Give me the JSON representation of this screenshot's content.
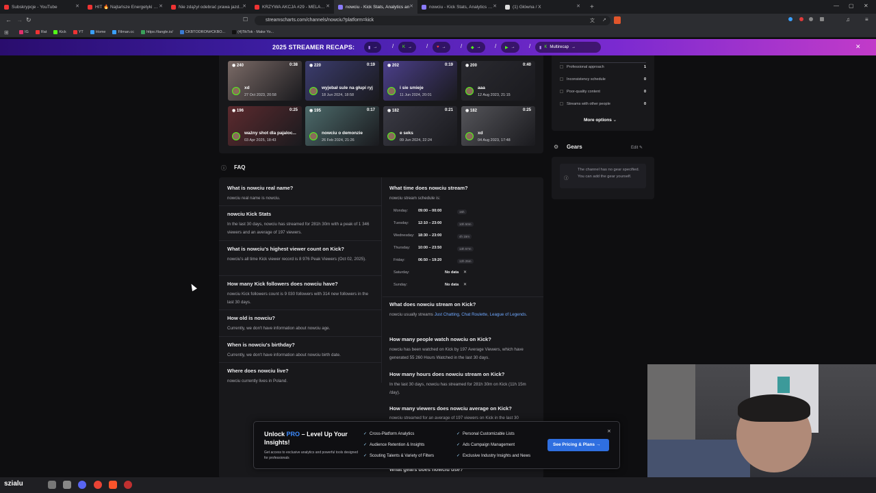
{
  "browser": {
    "tabs": [
      {
        "title": "Subskrypcje - YouTube",
        "color": "#e33"
      },
      {
        "title": "HIT 🔥 Najtańsze Energetyki W HIST",
        "color": "#e33"
      },
      {
        "title": "Nie zdążył odebrać prawa jazdy a już",
        "color": "#e33"
      },
      {
        "title": "KRZYWA AKCJA #29 - MELANŻOWA",
        "color": "#e33"
      },
      {
        "title": "nowciu - Kick Stats, Analytics an",
        "color": "#8a7bff"
      },
      {
        "title": "nowciu - Kick Stats, Analytics and Ch",
        "color": "#8a7bff"
      },
      {
        "title": "(1) Główna / X",
        "color": "#ddd"
      }
    ],
    "url": "streamscharts.com/channels/nowciu?platform=kick",
    "bookmarks": [
      "IG",
      "Rat",
      "Kick",
      "YT",
      "Home",
      "Filman.cc",
      "https://tangle.io/",
      "CKBTODRON#CKBO...",
      "(4)TikTok - Make Yo..."
    ]
  },
  "banner": {
    "title": "2025 STREAMER RECAPS:",
    "multirecap": "Multirecap"
  },
  "clips": [
    {
      "views": "240",
      "dur": "0:38",
      "title": "xd",
      "date": "27 Oct 2023, 20:58",
      "bg": "#7a6a66"
    },
    {
      "views": "220",
      "dur": "0:19",
      "title": "wyjebał sule na głupi ryj",
      "date": "18 Jun 2024, 18:58",
      "bg": "#3b3c6e"
    },
    {
      "views": "202",
      "dur": "0:19",
      "title": "i sie smieje",
      "date": "11 Jun 2024, 20:01",
      "bg": "#4b3f8a"
    },
    {
      "views": "200",
      "dur": "0:40",
      "title": "aaa",
      "date": "12 Aug 2023, 21:15",
      "bg": "#2a2a30"
    },
    {
      "views": "196",
      "dur": "0:25",
      "title": "ważny shot dla pajaloc...",
      "date": "03 Apr 2025, 18:43",
      "bg": "#5c2a2e"
    },
    {
      "views": "195",
      "dur": "0:17",
      "title": "nowciu o demonzie",
      "date": "26 Feb 2024, 21:26",
      "bg": "#4c6a6a"
    },
    {
      "views": "182",
      "dur": "0:21",
      "title": "e seks",
      "date": "09 Jun 2024, 22:24",
      "bg": "#3a3a44"
    },
    {
      "views": "182",
      "dur": "0:25",
      "title": "xd",
      "date": "04 Aug 2023, 17:48",
      "bg": "#55555a"
    }
  ],
  "right_panel": {
    "reasons": [
      {
        "label": "Professional approach",
        "count": "1"
      },
      {
        "label": "Inconsistency schedule",
        "count": "0"
      },
      {
        "label": "Poor-quality content",
        "count": "0"
      },
      {
        "label": "Streams with other people",
        "count": "0"
      }
    ],
    "more_options": "More options",
    "gears_title": "Gears",
    "gears_edit": "Edit",
    "gears_empty": "The channel has no gear specified. You can add the gear yourself."
  },
  "faq": {
    "title": "FAQ",
    "left": [
      {
        "q": "What is nowciu real name?",
        "a": "nowciu real name is nowciu."
      },
      {
        "q": "nowciu Kick Stats",
        "a": "In the last 30 days, nowciu has streamed for 281h 30m with a peak of 1 346 viewers and an average of 197 viewers."
      },
      {
        "q": "What is nowciu's highest viewer count on Kick?",
        "a": "nowciu's all time Kick viewer record is 8 976 Peak Viewers (Oct 02, 2025)."
      },
      {
        "q": "How many Kick followers does nowciu have?",
        "a": "nowciu Kick followers count is 9 030 followers with 314 new followers in the last 30 days."
      },
      {
        "q": "How old is nowciu?",
        "a": "Currently, we don't have information about nowciu age."
      },
      {
        "q": "When is nowciu's birthday?",
        "a": "Currently, we don't have information about nowciu birth date."
      },
      {
        "q": "Where does nowciu live?",
        "a": "nowciu currently lives in Poland."
      }
    ],
    "stream_time_q": "What time does nowciu stream?",
    "stream_time_a": "nowciu stream schedule is:",
    "schedule": [
      {
        "day": "Monday:",
        "time": "09:00 – 00:00",
        "dur": "15h"
      },
      {
        "day": "Tuesday:",
        "time": "12:10 – 23:00",
        "dur": "10h 50m"
      },
      {
        "day": "Wednesday:",
        "time": "18:30 – 23:00",
        "dur": "4h 15m"
      },
      {
        "day": "Thursday:",
        "time": "10:00 – 23:50",
        "dur": "13h 57m"
      },
      {
        "day": "Friday:",
        "time": "06:50 – 19:20",
        "dur": "12h 25m"
      },
      {
        "day": "Saturday:",
        "time": "No data",
        "dur": ""
      },
      {
        "day": "Sunday:",
        "time": "No data",
        "dur": ""
      }
    ],
    "what_stream_q": "What does nowciu stream on Kick?",
    "what_stream_a": "nowciu usually streams",
    "categories": [
      "Just Chatting",
      "Chat Roulette",
      "League of Legends"
    ],
    "people_q": "How many people watch nowciu on Kick?",
    "people_a": "nowciu has been watched on Kick by 197 Average Viewers, which have generated 55 260 Hours Watched in the last 30 days.",
    "hours_q": "How many hours does nowciu stream on Kick?",
    "hours_a": "In the last 30 days, nowciu has streamed for 281h 30m on Kick (11h 15m /day).",
    "avg_q": "How many viewers does nowciu average on Kick?",
    "avg_a": "nowciu streamed for an average of 197 viewers on Kick in the last 30",
    "gears_q": "What gears does nowciu use?"
  },
  "promo": {
    "title_a": "Unlock",
    "title_pro": "PRO",
    "title_b": "– Level Up Your Insights!",
    "sub": "Get access to exclusive analytics and powerful tools designed for professionals",
    "features": [
      "Cross-Platform Analytics",
      "Personal Customizable Lists",
      "Audience Retention & Insights",
      "Ads Campaign Management",
      "Scouting Talents & Variety of Filters",
      "Exclusive Industry Insights and News"
    ],
    "cta": "See Pricing & Plans"
  },
  "taskbar": {
    "label": "szialu"
  },
  "colors": {
    "accent": "#2d8cff",
    "kick": "#53fc18",
    "cta": "#2f6fe0"
  }
}
